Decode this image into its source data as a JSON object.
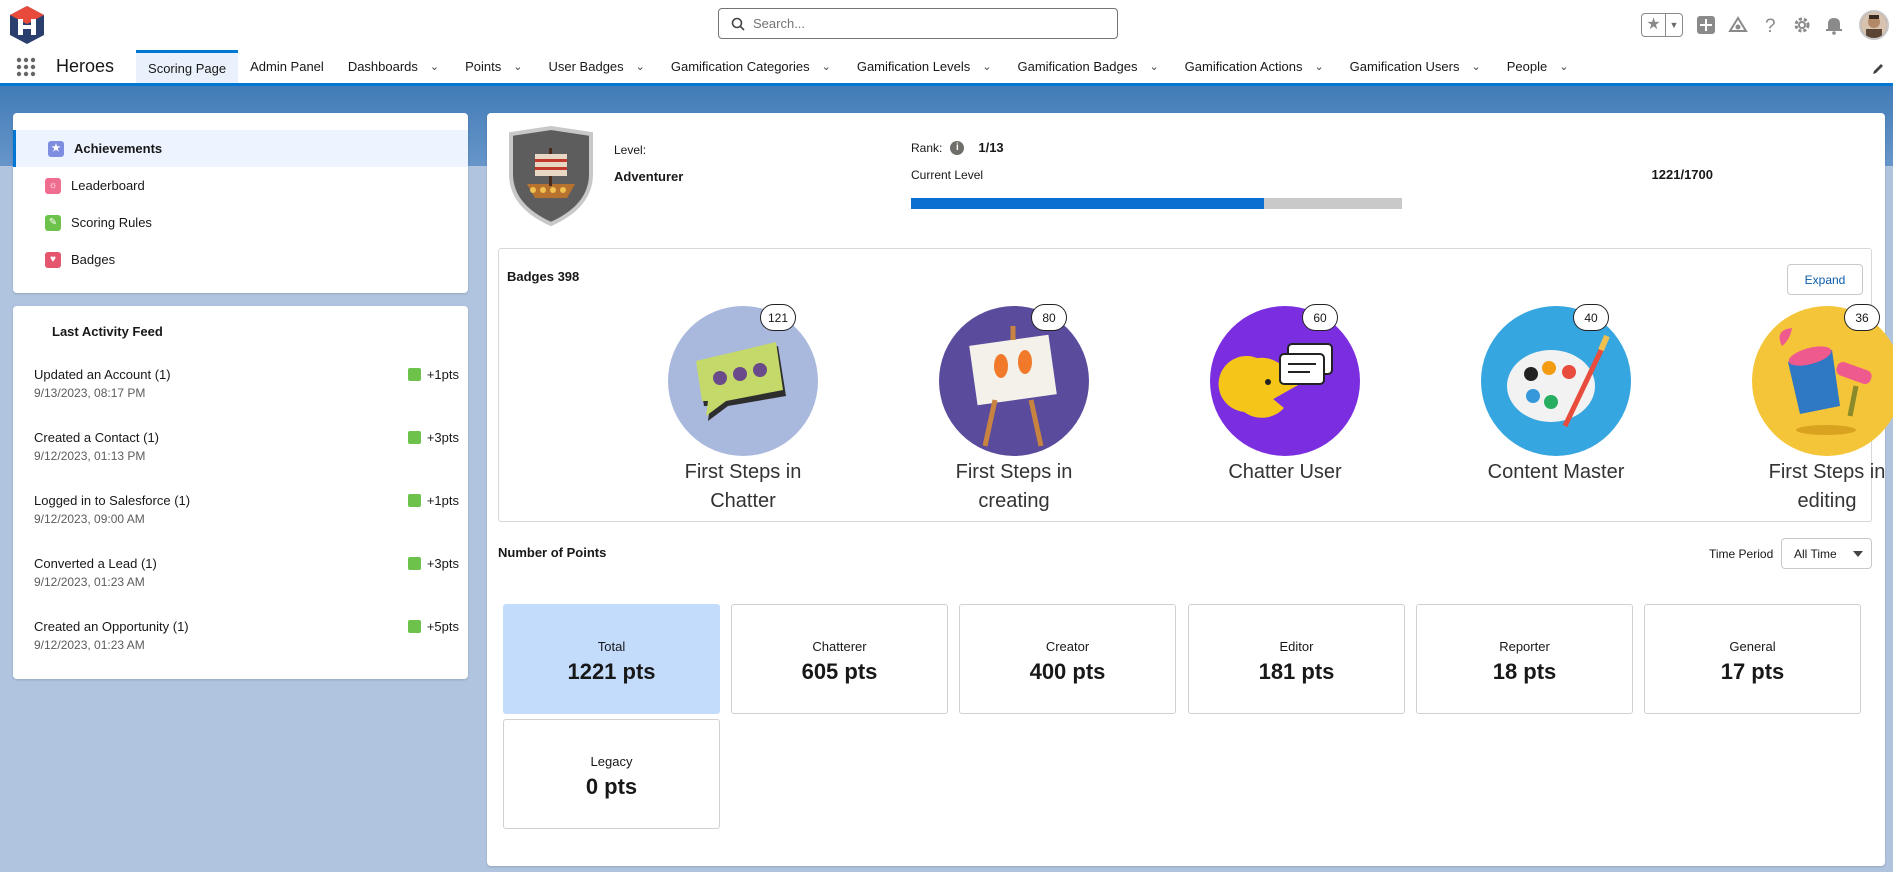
{
  "header": {
    "search_placeholder": "Search...",
    "icons": [
      "favorites-star-icon",
      "add-icon",
      "trailhead-icon",
      "help-icon",
      "setup-gear-icon",
      "notifications-bell-icon",
      "user-avatar"
    ]
  },
  "nav": {
    "app_name": "Heroes",
    "tabs": [
      {
        "label": "Scoring Page",
        "active": true,
        "has_menu": false
      },
      {
        "label": "Admin Panel",
        "has_menu": false
      },
      {
        "label": "Dashboards",
        "has_menu": true
      },
      {
        "label": "Points",
        "has_menu": true
      },
      {
        "label": "User Badges",
        "has_menu": true
      },
      {
        "label": "Gamification Categories",
        "has_menu": true
      },
      {
        "label": "Gamification Levels",
        "has_menu": true
      },
      {
        "label": "Gamification Badges",
        "has_menu": true
      },
      {
        "label": "Gamification Actions",
        "has_menu": true
      },
      {
        "label": "Gamification Users",
        "has_menu": true
      },
      {
        "label": "People",
        "has_menu": true
      }
    ]
  },
  "sidebar": {
    "items": [
      {
        "label": "Achievements",
        "active": true,
        "icon": "star-icon",
        "color": "#7f8de1"
      },
      {
        "label": "Leaderboard",
        "icon": "ribbon-icon",
        "color": "#ef6e90"
      },
      {
        "label": "Scoring Rules",
        "icon": "rules-icon",
        "color": "#6cc24a"
      },
      {
        "label": "Badges",
        "icon": "trophy-icon",
        "color": "#e3566e"
      }
    ]
  },
  "feed": {
    "title": "Last Activity Feed",
    "items": [
      {
        "action": "Updated an Account (1)",
        "time": "9/13/2023, 08:17 PM",
        "points": "+1pts"
      },
      {
        "action": "Created a Contact (1)",
        "time": "9/12/2023, 01:13 PM",
        "points": "+3pts"
      },
      {
        "action": "Logged in to Salesforce (1)",
        "time": "9/12/2023, 09:00 AM",
        "points": "+1pts"
      },
      {
        "action": "Converted a Lead (1)",
        "time": "9/12/2023, 01:23 AM",
        "points": "+3pts"
      },
      {
        "action": "Created an Opportunity (1)",
        "time": "9/12/2023, 01:23 AM",
        "points": "+5pts"
      }
    ]
  },
  "level": {
    "label": "Level:",
    "value": "Adventurer",
    "rank_label": "Rank:",
    "rank_value": "1/13",
    "current_label": "Current Level",
    "current_value": "1221/1700",
    "progress": 0.718
  },
  "badges": {
    "title": "Badges 398",
    "expand_label": "Expand",
    "items": [
      {
        "name_line1": "First Steps in",
        "name_line2": "Chatter",
        "count": "121",
        "bg": "#a9b8dd"
      },
      {
        "name_line1": "First Steps in",
        "name_line2": "creating",
        "count": "80",
        "bg": "#5a4b9c"
      },
      {
        "name_line1": "Chatter User",
        "name_line2": "",
        "count": "60",
        "bg": "#7a2ee0"
      },
      {
        "name_line1": "Content Master",
        "name_line2": "",
        "count": "40",
        "bg": "#36a6e0"
      },
      {
        "name_line1": "First Steps in",
        "name_line2": "editing",
        "count": "36",
        "bg": "#f4c538"
      }
    ]
  },
  "points": {
    "title": "Number of Points",
    "period_label": "Time Period",
    "period_value": "All Time",
    "tiles": [
      {
        "label": "Total",
        "value": "1221 pts"
      },
      {
        "label": "Chatterer",
        "value": "605 pts"
      },
      {
        "label": "Creator",
        "value": "400 pts"
      },
      {
        "label": "Editor",
        "value": "181 pts"
      },
      {
        "label": "Reporter",
        "value": "18 pts"
      },
      {
        "label": "General",
        "value": "17 pts"
      },
      {
        "label": "Legacy",
        "value": "0 pts"
      }
    ]
  }
}
